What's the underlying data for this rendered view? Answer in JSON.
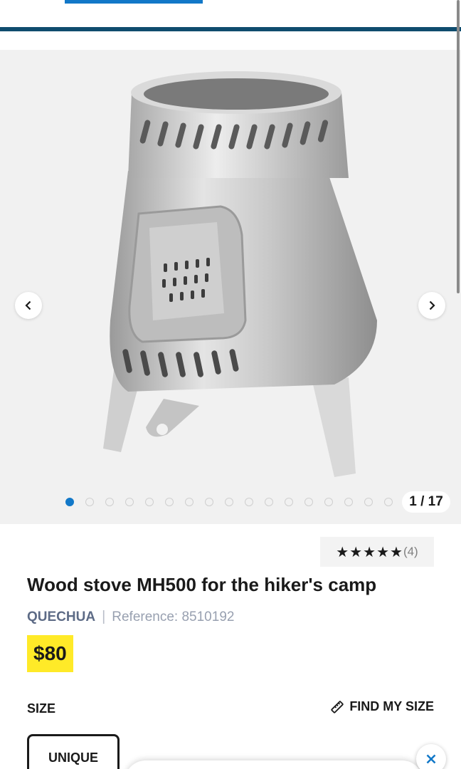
{
  "gallery": {
    "current": 1,
    "total": 17,
    "counter_text": "1 / 17",
    "dot_count": 17,
    "prev_icon": "chevron-left-icon",
    "next_icon": "chevron-right-icon"
  },
  "product": {
    "stars": "★★★★★",
    "rating_value": 5,
    "review_count": "(4)",
    "title": "Wood stove MH500 for the hiker's camp",
    "brand": "QUECHUA",
    "separator": "|",
    "reference": "Reference: 8510192",
    "price": "$80"
  },
  "size": {
    "label": "SIZE",
    "find_label": "FIND MY SIZE",
    "find_icon": "ruler-icon",
    "option": "UNIQUE"
  },
  "colors": {
    "accent": "#1278c8",
    "header_rule": "#0f4c6e",
    "price_badge": "#ffea28",
    "brand_text": "#5d6b86"
  },
  "close_icon": "close-icon"
}
